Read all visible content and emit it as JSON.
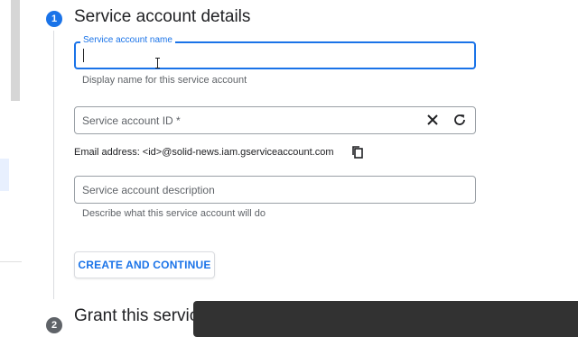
{
  "step1": {
    "number": "1",
    "title": "Service account details"
  },
  "name_field": {
    "label": "Service account name",
    "helper": "Display name for this service account"
  },
  "id_field": {
    "placeholder": "Service account ID *"
  },
  "email_line": "Email address: <id>@solid-news.iam.gserviceaccount.com",
  "description_field": {
    "placeholder": "Service account description",
    "helper": "Describe what this service account will do"
  },
  "create_button": "CREATE AND CONTINUE",
  "step2": {
    "number": "2",
    "title": "Grant this servic"
  },
  "icons": {
    "clear": "close-icon",
    "refresh": "refresh-icon",
    "copy": "copy-icon"
  },
  "colors": {
    "accent": "#1a73e8",
    "muted": "#5f6368",
    "border": "#9aa0a6"
  }
}
